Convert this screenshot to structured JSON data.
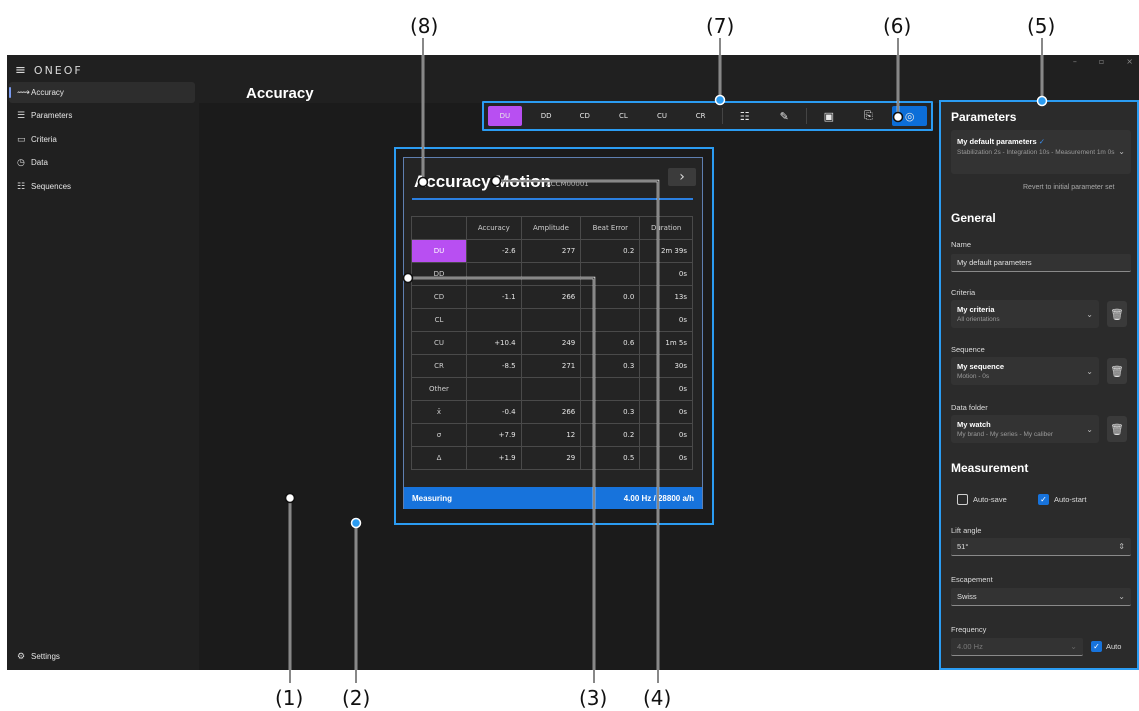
{
  "callouts": [
    "(8)",
    "(7)",
    "(6)",
    "(5)",
    "(1)",
    "(2)",
    "(3)",
    "(4)"
  ],
  "app": {
    "brand": "ONEOF",
    "menu_icon": "hamburger-icon"
  },
  "window_controls": [
    "–",
    "▫",
    "×"
  ],
  "sidebar": {
    "items": [
      {
        "label": "Accuracy",
        "icon": "accuracy-icon",
        "glyph": "⟿",
        "active": true
      },
      {
        "label": "Parameters",
        "icon": "sliders-icon",
        "glyph": "☰"
      },
      {
        "label": "Criteria",
        "icon": "monitor-icon",
        "glyph": "▭"
      },
      {
        "label": "Data",
        "icon": "stopwatch-icon",
        "glyph": "◷"
      },
      {
        "label": "Sequences",
        "icon": "list-icon",
        "glyph": "☷"
      }
    ],
    "settings": {
      "label": "Settings",
      "icon": "gear-icon",
      "glyph": "⚙"
    }
  },
  "page_title": "Accuracy",
  "toolbar": {
    "orientations": [
      "DU",
      "DD",
      "CD",
      "CL",
      "CU",
      "CR"
    ],
    "active": "DU",
    "icons": [
      {
        "name": "list-icon",
        "glyph": "☷"
      },
      {
        "name": "ruler-icon",
        "glyph": "✎"
      },
      {
        "name": "save-icon",
        "glyph": "▣"
      },
      {
        "name": "export-icon",
        "glyph": "⎘"
      }
    ],
    "settings_glyph": "◎"
  },
  "card": {
    "title": "Accuracy Motion",
    "id": "ACCM00001",
    "next_glyph": "›",
    "columns": [
      "Accuracy",
      "Amplitude",
      "Beat Error",
      "Duration"
    ],
    "rows": [
      {
        "label": "DU",
        "active": true,
        "cells": [
          "-2.6",
          "277",
          "0.2",
          "2m 39s"
        ]
      },
      {
        "label": "DD",
        "cells": [
          "",
          "",
          "",
          "0s"
        ]
      },
      {
        "label": "CD",
        "cells": [
          "-1.1",
          "266",
          "0.0",
          "13s"
        ]
      },
      {
        "label": "CL",
        "cells": [
          "",
          "",
          "",
          "0s"
        ]
      },
      {
        "label": "CU",
        "cells": [
          "+10.4",
          "249",
          "0.6",
          "1m 5s"
        ]
      },
      {
        "label": "CR",
        "cells": [
          "-8.5",
          "271",
          "0.3",
          "30s"
        ]
      },
      {
        "label": "Other",
        "cells": [
          "",
          "",
          "",
          "0s"
        ]
      },
      {
        "label": "x̄",
        "cells": [
          "-0.4",
          "266",
          "0.3",
          "0s"
        ]
      },
      {
        "label": "σ",
        "cells": [
          "+7.9",
          "12",
          "0.2",
          "0s"
        ]
      },
      {
        "label": "Δ",
        "cells": [
          "+1.9",
          "29",
          "0.5",
          "0s"
        ]
      }
    ],
    "status": "Measuring",
    "frequency": "4.00 Hz / 28800 a/h"
  },
  "panel": {
    "title": "Parameters",
    "preset": {
      "name": "My default parameters",
      "check_icon": "verified-icon",
      "detail": "Stabilization 2s - Integration 10s - Measurement 1m 0s"
    },
    "revert_label": "Revert to initial parameter set",
    "general_heading": "General",
    "name_label": "Name",
    "name_value": "My default parameters",
    "criteria": {
      "label": "Criteria",
      "value": "My criteria",
      "sub": "All orientations"
    },
    "sequence": {
      "label": "Sequence",
      "value": "My sequence",
      "sub": "Motion - 0s"
    },
    "data_folder": {
      "label": "Data folder",
      "value": "My watch",
      "sub": "My brand - My series - My caliber"
    },
    "measurement_heading": "Measurement",
    "autosave_label": "Auto-save",
    "autosave": false,
    "autostart_label": "Auto-start",
    "autostart": true,
    "lift_angle": {
      "label": "Lift angle",
      "value": "51°"
    },
    "escapement": {
      "label": "Escapement",
      "value": "Swiss"
    },
    "frequency": {
      "label": "Frequency",
      "value": "4.00 Hz",
      "auto_label": "Auto",
      "auto": true
    }
  }
}
